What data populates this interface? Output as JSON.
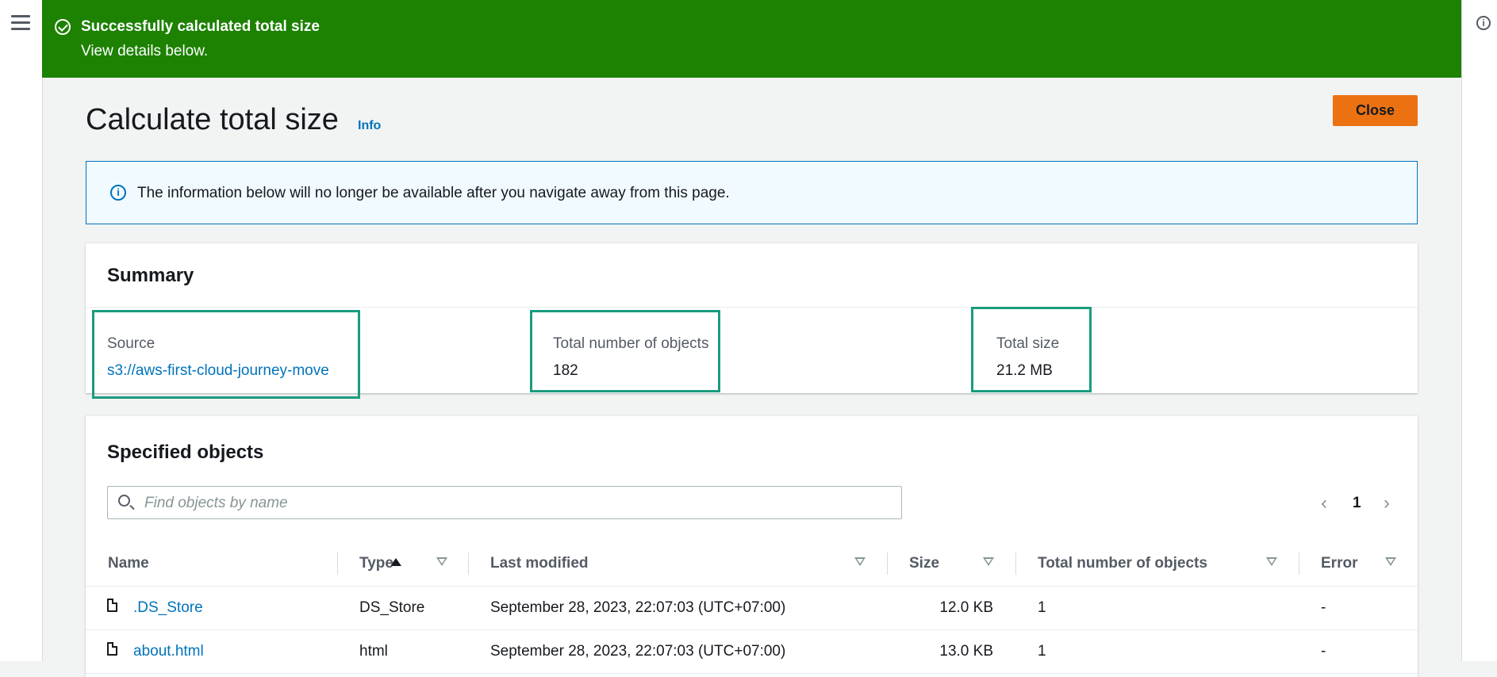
{
  "flash": {
    "title": "Successfully calculated total size",
    "subtitle": "View details below."
  },
  "page": {
    "title": "Calculate total size",
    "info_label": "Info",
    "close_label": "Close"
  },
  "alert": {
    "text": "The information below will no longer be available after you navigate away from this page."
  },
  "summary": {
    "title": "Summary",
    "source_label": "Source",
    "source_value": "s3://aws-first-cloud-journey-move",
    "objects_label": "Total number of objects",
    "objects_value": "182",
    "size_label": "Total size",
    "size_value": "21.2 MB"
  },
  "objects": {
    "title": "Specified objects",
    "search_placeholder": "Find objects by name",
    "pagination": {
      "prev": "‹",
      "page": "1",
      "next": "›"
    },
    "columns": {
      "name": "Name",
      "type": "Type",
      "last_modified": "Last modified",
      "size": "Size",
      "total_objects": "Total number of objects",
      "error": "Error"
    },
    "rows": [
      {
        "name": ".DS_Store",
        "type": "DS_Store",
        "last_modified": "September 28, 2023, 22:07:03 (UTC+07:00)",
        "size": "12.0 KB",
        "total_objects": "1",
        "error": "-"
      },
      {
        "name": "about.html",
        "type": "html",
        "last_modified": "September 28, 2023, 22:07:03 (UTC+07:00)",
        "size": "13.0 KB",
        "total_objects": "1",
        "error": "-"
      }
    ]
  },
  "colors": {
    "success": "#1d8102",
    "primary_button": "#ec7211",
    "link": "#0073bb",
    "highlight": "#1a9c7e"
  }
}
